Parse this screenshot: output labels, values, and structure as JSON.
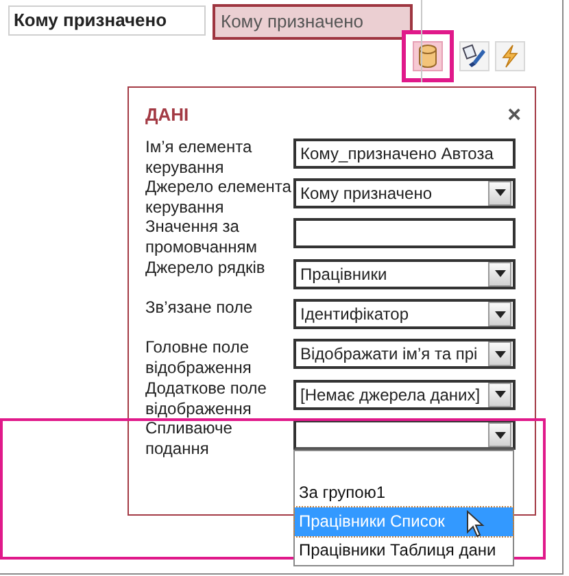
{
  "top_label": "Кому призначено",
  "top_field": {
    "value": "Кому призначено",
    "selected": true
  },
  "toolbar": [
    {
      "kind": "data",
      "selected": true
    },
    {
      "kind": "format",
      "selected": false
    },
    {
      "kind": "event",
      "selected": false
    }
  ],
  "panel": {
    "title": "ДАНІ",
    "close": "×",
    "properties": [
      {
        "label": "Ім’я елемента керування",
        "value": "Кому_призначено Автоза",
        "kind": "text"
      },
      {
        "label": "Джерело елемента керування",
        "value": "Кому призначено",
        "kind": "dropdown"
      },
      {
        "label": "Значення за промовчанням",
        "kind": "text"
      },
      {
        "label": "Джерело рядків",
        "value": "Працівники",
        "kind": "dropdown"
      },
      {
        "label": "Зв’язане поле",
        "value": "Ідентифікатор",
        "kind": "dropdown"
      },
      {
        "label": "Головне поле відображення",
        "value": "Відображати ім’я та прі",
        "kind": "dropdown"
      },
      {
        "label": "Додаткове поле відображення",
        "value": "[Немає джерела даних]",
        "kind": "dropdown"
      },
      {
        "label": "Спливаюче подання",
        "kind": "dropdown",
        "expanded": true
      }
    ],
    "popup_list": [
      {
        "label": "За групою1",
        "selected": false
      },
      {
        "label": "Працівники Список",
        "selected": true
      },
      {
        "label": "Працівники Таблиця дани",
        "selected": false
      }
    ]
  }
}
